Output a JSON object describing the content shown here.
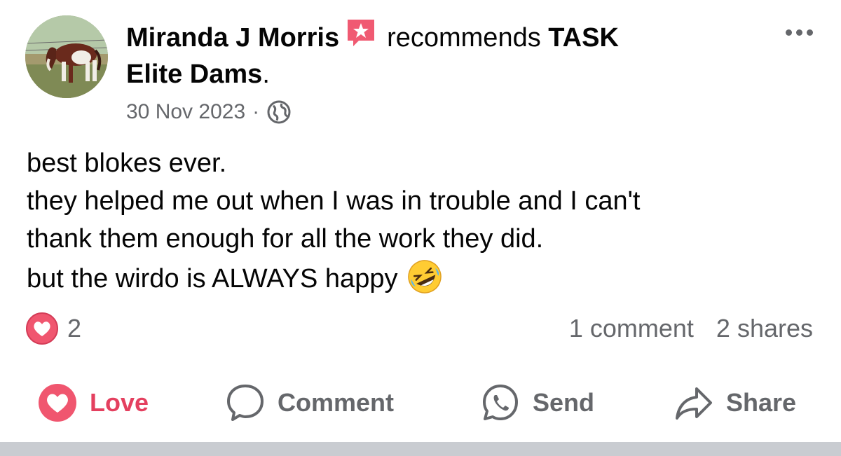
{
  "author": {
    "name": "Miranda J Morris",
    "avatar_icon": "profile-photo-horse",
    "recommend_icon": "recommend-star-icon"
  },
  "header": {
    "verb": "recommends",
    "page_name_part1": "TASK",
    "page_name_part2": "Elite Dams",
    "period": "."
  },
  "meta": {
    "date": "30 Nov 2023",
    "separator": "·",
    "privacy_icon": "globe-icon"
  },
  "post": {
    "lines": [
      "best blokes ever.",
      "they helped me out when I was in trouble and I can't",
      "thank them enough for all the work they did.",
      "but the wirdo is ALWAYS happy"
    ],
    "emoji": "rolling-on-floor-laughing-emoji"
  },
  "stats": {
    "reaction_count": "2",
    "comments": "1 comment",
    "shares": "2 shares"
  },
  "actions": {
    "love": "Love",
    "comment": "Comment",
    "send": "Send",
    "share": "Share"
  },
  "colors": {
    "love_accent": "#e4405f",
    "secondary_text": "#65676b",
    "primary_text": "#050505"
  }
}
